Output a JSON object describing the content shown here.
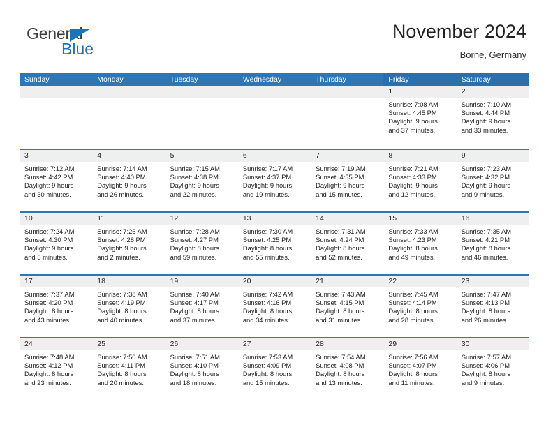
{
  "brand": {
    "name_part1": "General",
    "name_part2": "Blue",
    "triangle_icon": "brand-triangle-icon",
    "accent_color": "#1b75bb"
  },
  "header": {
    "title": "November 2024",
    "subtitle": "Borne, Germany"
  },
  "theme": {
    "header_blue": "#2f76b5",
    "header_blue_alt": "#2d6fab",
    "daynum_band": "#efefef",
    "text": "#1d1d1d"
  },
  "calendar": {
    "weekdays": [
      "Sunday",
      "Monday",
      "Tuesday",
      "Wednesday",
      "Thursday",
      "Friday",
      "Saturday"
    ],
    "weeks": [
      [
        {
          "day": "",
          "sunrise": "",
          "sunset": "",
          "daylight1": "",
          "daylight2": ""
        },
        {
          "day": "",
          "sunrise": "",
          "sunset": "",
          "daylight1": "",
          "daylight2": ""
        },
        {
          "day": "",
          "sunrise": "",
          "sunset": "",
          "daylight1": "",
          "daylight2": ""
        },
        {
          "day": "",
          "sunrise": "",
          "sunset": "",
          "daylight1": "",
          "daylight2": ""
        },
        {
          "day": "",
          "sunrise": "",
          "sunset": "",
          "daylight1": "",
          "daylight2": ""
        },
        {
          "day": "1",
          "sunrise": "Sunrise: 7:08 AM",
          "sunset": "Sunset: 4:45 PM",
          "daylight1": "Daylight: 9 hours",
          "daylight2": "and 37 minutes."
        },
        {
          "day": "2",
          "sunrise": "Sunrise: 7:10 AM",
          "sunset": "Sunset: 4:44 PM",
          "daylight1": "Daylight: 9 hours",
          "daylight2": "and 33 minutes."
        }
      ],
      [
        {
          "day": "3",
          "sunrise": "Sunrise: 7:12 AM",
          "sunset": "Sunset: 4:42 PM",
          "daylight1": "Daylight: 9 hours",
          "daylight2": "and 30 minutes."
        },
        {
          "day": "4",
          "sunrise": "Sunrise: 7:14 AM",
          "sunset": "Sunset: 4:40 PM",
          "daylight1": "Daylight: 9 hours",
          "daylight2": "and 26 minutes."
        },
        {
          "day": "5",
          "sunrise": "Sunrise: 7:15 AM",
          "sunset": "Sunset: 4:38 PM",
          "daylight1": "Daylight: 9 hours",
          "daylight2": "and 22 minutes."
        },
        {
          "day": "6",
          "sunrise": "Sunrise: 7:17 AM",
          "sunset": "Sunset: 4:37 PM",
          "daylight1": "Daylight: 9 hours",
          "daylight2": "and 19 minutes."
        },
        {
          "day": "7",
          "sunrise": "Sunrise: 7:19 AM",
          "sunset": "Sunset: 4:35 PM",
          "daylight1": "Daylight: 9 hours",
          "daylight2": "and 15 minutes."
        },
        {
          "day": "8",
          "sunrise": "Sunrise: 7:21 AM",
          "sunset": "Sunset: 4:33 PM",
          "daylight1": "Daylight: 9 hours",
          "daylight2": "and 12 minutes."
        },
        {
          "day": "9",
          "sunrise": "Sunrise: 7:23 AM",
          "sunset": "Sunset: 4:32 PM",
          "daylight1": "Daylight: 9 hours",
          "daylight2": "and 9 minutes."
        }
      ],
      [
        {
          "day": "10",
          "sunrise": "Sunrise: 7:24 AM",
          "sunset": "Sunset: 4:30 PM",
          "daylight1": "Daylight: 9 hours",
          "daylight2": "and 5 minutes."
        },
        {
          "day": "11",
          "sunrise": "Sunrise: 7:26 AM",
          "sunset": "Sunset: 4:28 PM",
          "daylight1": "Daylight: 9 hours",
          "daylight2": "and 2 minutes."
        },
        {
          "day": "12",
          "sunrise": "Sunrise: 7:28 AM",
          "sunset": "Sunset: 4:27 PM",
          "daylight1": "Daylight: 8 hours",
          "daylight2": "and 59 minutes."
        },
        {
          "day": "13",
          "sunrise": "Sunrise: 7:30 AM",
          "sunset": "Sunset: 4:25 PM",
          "daylight1": "Daylight: 8 hours",
          "daylight2": "and 55 minutes."
        },
        {
          "day": "14",
          "sunrise": "Sunrise: 7:31 AM",
          "sunset": "Sunset: 4:24 PM",
          "daylight1": "Daylight: 8 hours",
          "daylight2": "and 52 minutes."
        },
        {
          "day": "15",
          "sunrise": "Sunrise: 7:33 AM",
          "sunset": "Sunset: 4:23 PM",
          "daylight1": "Daylight: 8 hours",
          "daylight2": "and 49 minutes."
        },
        {
          "day": "16",
          "sunrise": "Sunrise: 7:35 AM",
          "sunset": "Sunset: 4:21 PM",
          "daylight1": "Daylight: 8 hours",
          "daylight2": "and 46 minutes."
        }
      ],
      [
        {
          "day": "17",
          "sunrise": "Sunrise: 7:37 AM",
          "sunset": "Sunset: 4:20 PM",
          "daylight1": "Daylight: 8 hours",
          "daylight2": "and 43 minutes."
        },
        {
          "day": "18",
          "sunrise": "Sunrise: 7:38 AM",
          "sunset": "Sunset: 4:19 PM",
          "daylight1": "Daylight: 8 hours",
          "daylight2": "and 40 minutes."
        },
        {
          "day": "19",
          "sunrise": "Sunrise: 7:40 AM",
          "sunset": "Sunset: 4:17 PM",
          "daylight1": "Daylight: 8 hours",
          "daylight2": "and 37 minutes."
        },
        {
          "day": "20",
          "sunrise": "Sunrise: 7:42 AM",
          "sunset": "Sunset: 4:16 PM",
          "daylight1": "Daylight: 8 hours",
          "daylight2": "and 34 minutes."
        },
        {
          "day": "21",
          "sunrise": "Sunrise: 7:43 AM",
          "sunset": "Sunset: 4:15 PM",
          "daylight1": "Daylight: 8 hours",
          "daylight2": "and 31 minutes."
        },
        {
          "day": "22",
          "sunrise": "Sunrise: 7:45 AM",
          "sunset": "Sunset: 4:14 PM",
          "daylight1": "Daylight: 8 hours",
          "daylight2": "and 28 minutes."
        },
        {
          "day": "23",
          "sunrise": "Sunrise: 7:47 AM",
          "sunset": "Sunset: 4:13 PM",
          "daylight1": "Daylight: 8 hours",
          "daylight2": "and 26 minutes."
        }
      ],
      [
        {
          "day": "24",
          "sunrise": "Sunrise: 7:48 AM",
          "sunset": "Sunset: 4:12 PM",
          "daylight1": "Daylight: 8 hours",
          "daylight2": "and 23 minutes."
        },
        {
          "day": "25",
          "sunrise": "Sunrise: 7:50 AM",
          "sunset": "Sunset: 4:11 PM",
          "daylight1": "Daylight: 8 hours",
          "daylight2": "and 20 minutes."
        },
        {
          "day": "26",
          "sunrise": "Sunrise: 7:51 AM",
          "sunset": "Sunset: 4:10 PM",
          "daylight1": "Daylight: 8 hours",
          "daylight2": "and 18 minutes."
        },
        {
          "day": "27",
          "sunrise": "Sunrise: 7:53 AM",
          "sunset": "Sunset: 4:09 PM",
          "daylight1": "Daylight: 8 hours",
          "daylight2": "and 15 minutes."
        },
        {
          "day": "28",
          "sunrise": "Sunrise: 7:54 AM",
          "sunset": "Sunset: 4:08 PM",
          "daylight1": "Daylight: 8 hours",
          "daylight2": "and 13 minutes."
        },
        {
          "day": "29",
          "sunrise": "Sunrise: 7:56 AM",
          "sunset": "Sunset: 4:07 PM",
          "daylight1": "Daylight: 8 hours",
          "daylight2": "and 11 minutes."
        },
        {
          "day": "30",
          "sunrise": "Sunrise: 7:57 AM",
          "sunset": "Sunset: 4:06 PM",
          "daylight1": "Daylight: 8 hours",
          "daylight2": "and 9 minutes."
        }
      ]
    ]
  }
}
